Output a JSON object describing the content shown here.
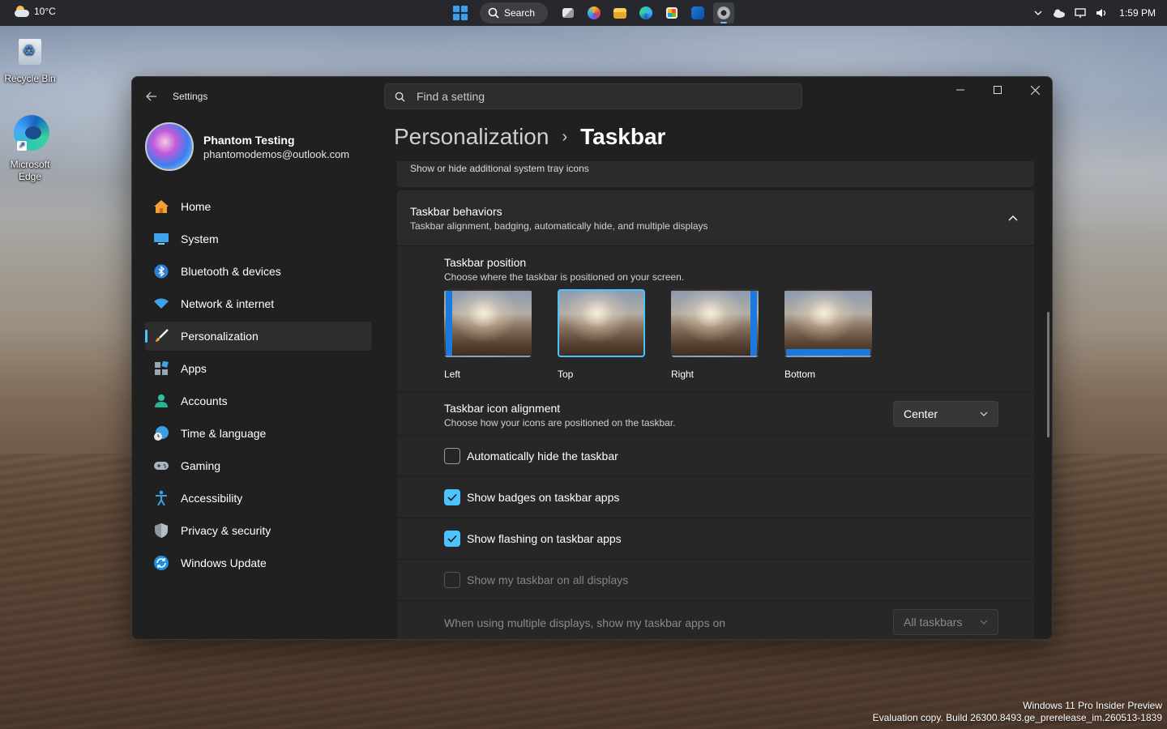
{
  "taskbar": {
    "weather": "10°C",
    "search_label": "Search",
    "time": "1:59 PM"
  },
  "desktop": {
    "recycle_bin": "Recycle Bin",
    "edge": "Microsoft Edge"
  },
  "window": {
    "title": "Settings",
    "search_placeholder": "Find a setting"
  },
  "profile": {
    "name": "Phantom Testing",
    "email": "phantomodemos@outlook.com"
  },
  "nav": {
    "items": [
      {
        "label": "Home",
        "icon": "home-icon"
      },
      {
        "label": "System",
        "icon": "system-icon"
      },
      {
        "label": "Bluetooth & devices",
        "icon": "bluetooth-icon"
      },
      {
        "label": "Network & internet",
        "icon": "wifi-icon"
      },
      {
        "label": "Personalization",
        "icon": "brush-icon",
        "selected": true
      },
      {
        "label": "Apps",
        "icon": "apps-icon"
      },
      {
        "label": "Accounts",
        "icon": "person-icon"
      },
      {
        "label": "Time & language",
        "icon": "clock-globe-icon"
      },
      {
        "label": "Gaming",
        "icon": "gamepad-icon"
      },
      {
        "label": "Accessibility",
        "icon": "accessibility-icon"
      },
      {
        "label": "Privacy & security",
        "icon": "shield-icon"
      },
      {
        "label": "Windows Update",
        "icon": "update-icon"
      }
    ]
  },
  "breadcrumb": {
    "parent": "Personalization",
    "separator": "›",
    "current": "Taskbar"
  },
  "content": {
    "tray_sub": "Show or hide additional system tray icons",
    "behaviors": {
      "title": "Taskbar behaviors",
      "subtitle": "Taskbar alignment, badging, automatically hide, and multiple displays"
    },
    "position": {
      "title": "Taskbar position",
      "subtitle": "Choose where the taskbar is positioned on your screen.",
      "options": [
        "Left",
        "Top",
        "Right",
        "Bottom"
      ],
      "selected": "Top"
    },
    "alignment": {
      "title": "Taskbar icon alignment",
      "subtitle": "Choose how your icons are positioned on the taskbar.",
      "value": "Center"
    },
    "checkboxes": [
      {
        "label": "Automatically hide the taskbar",
        "checked": false,
        "disabled": false
      },
      {
        "label": "Show badges on taskbar apps",
        "checked": true,
        "disabled": false
      },
      {
        "label": "Show flashing on taskbar apps",
        "checked": true,
        "disabled": false
      },
      {
        "label": "Show my taskbar on all displays",
        "checked": false,
        "disabled": true
      }
    ],
    "multi_display": {
      "label": "When using multiple displays, show my taskbar apps on",
      "value": "All taskbars"
    }
  },
  "watermark": {
    "line1": "Windows 11 Pro Insider Preview",
    "line2": "Evaluation copy. Build 26300.8493.ge_prerelease_im.260513-1839"
  },
  "colors": {
    "accent": "#4cc2ff",
    "window_bg": "#202020",
    "card_bg": "#2b2b2b"
  }
}
